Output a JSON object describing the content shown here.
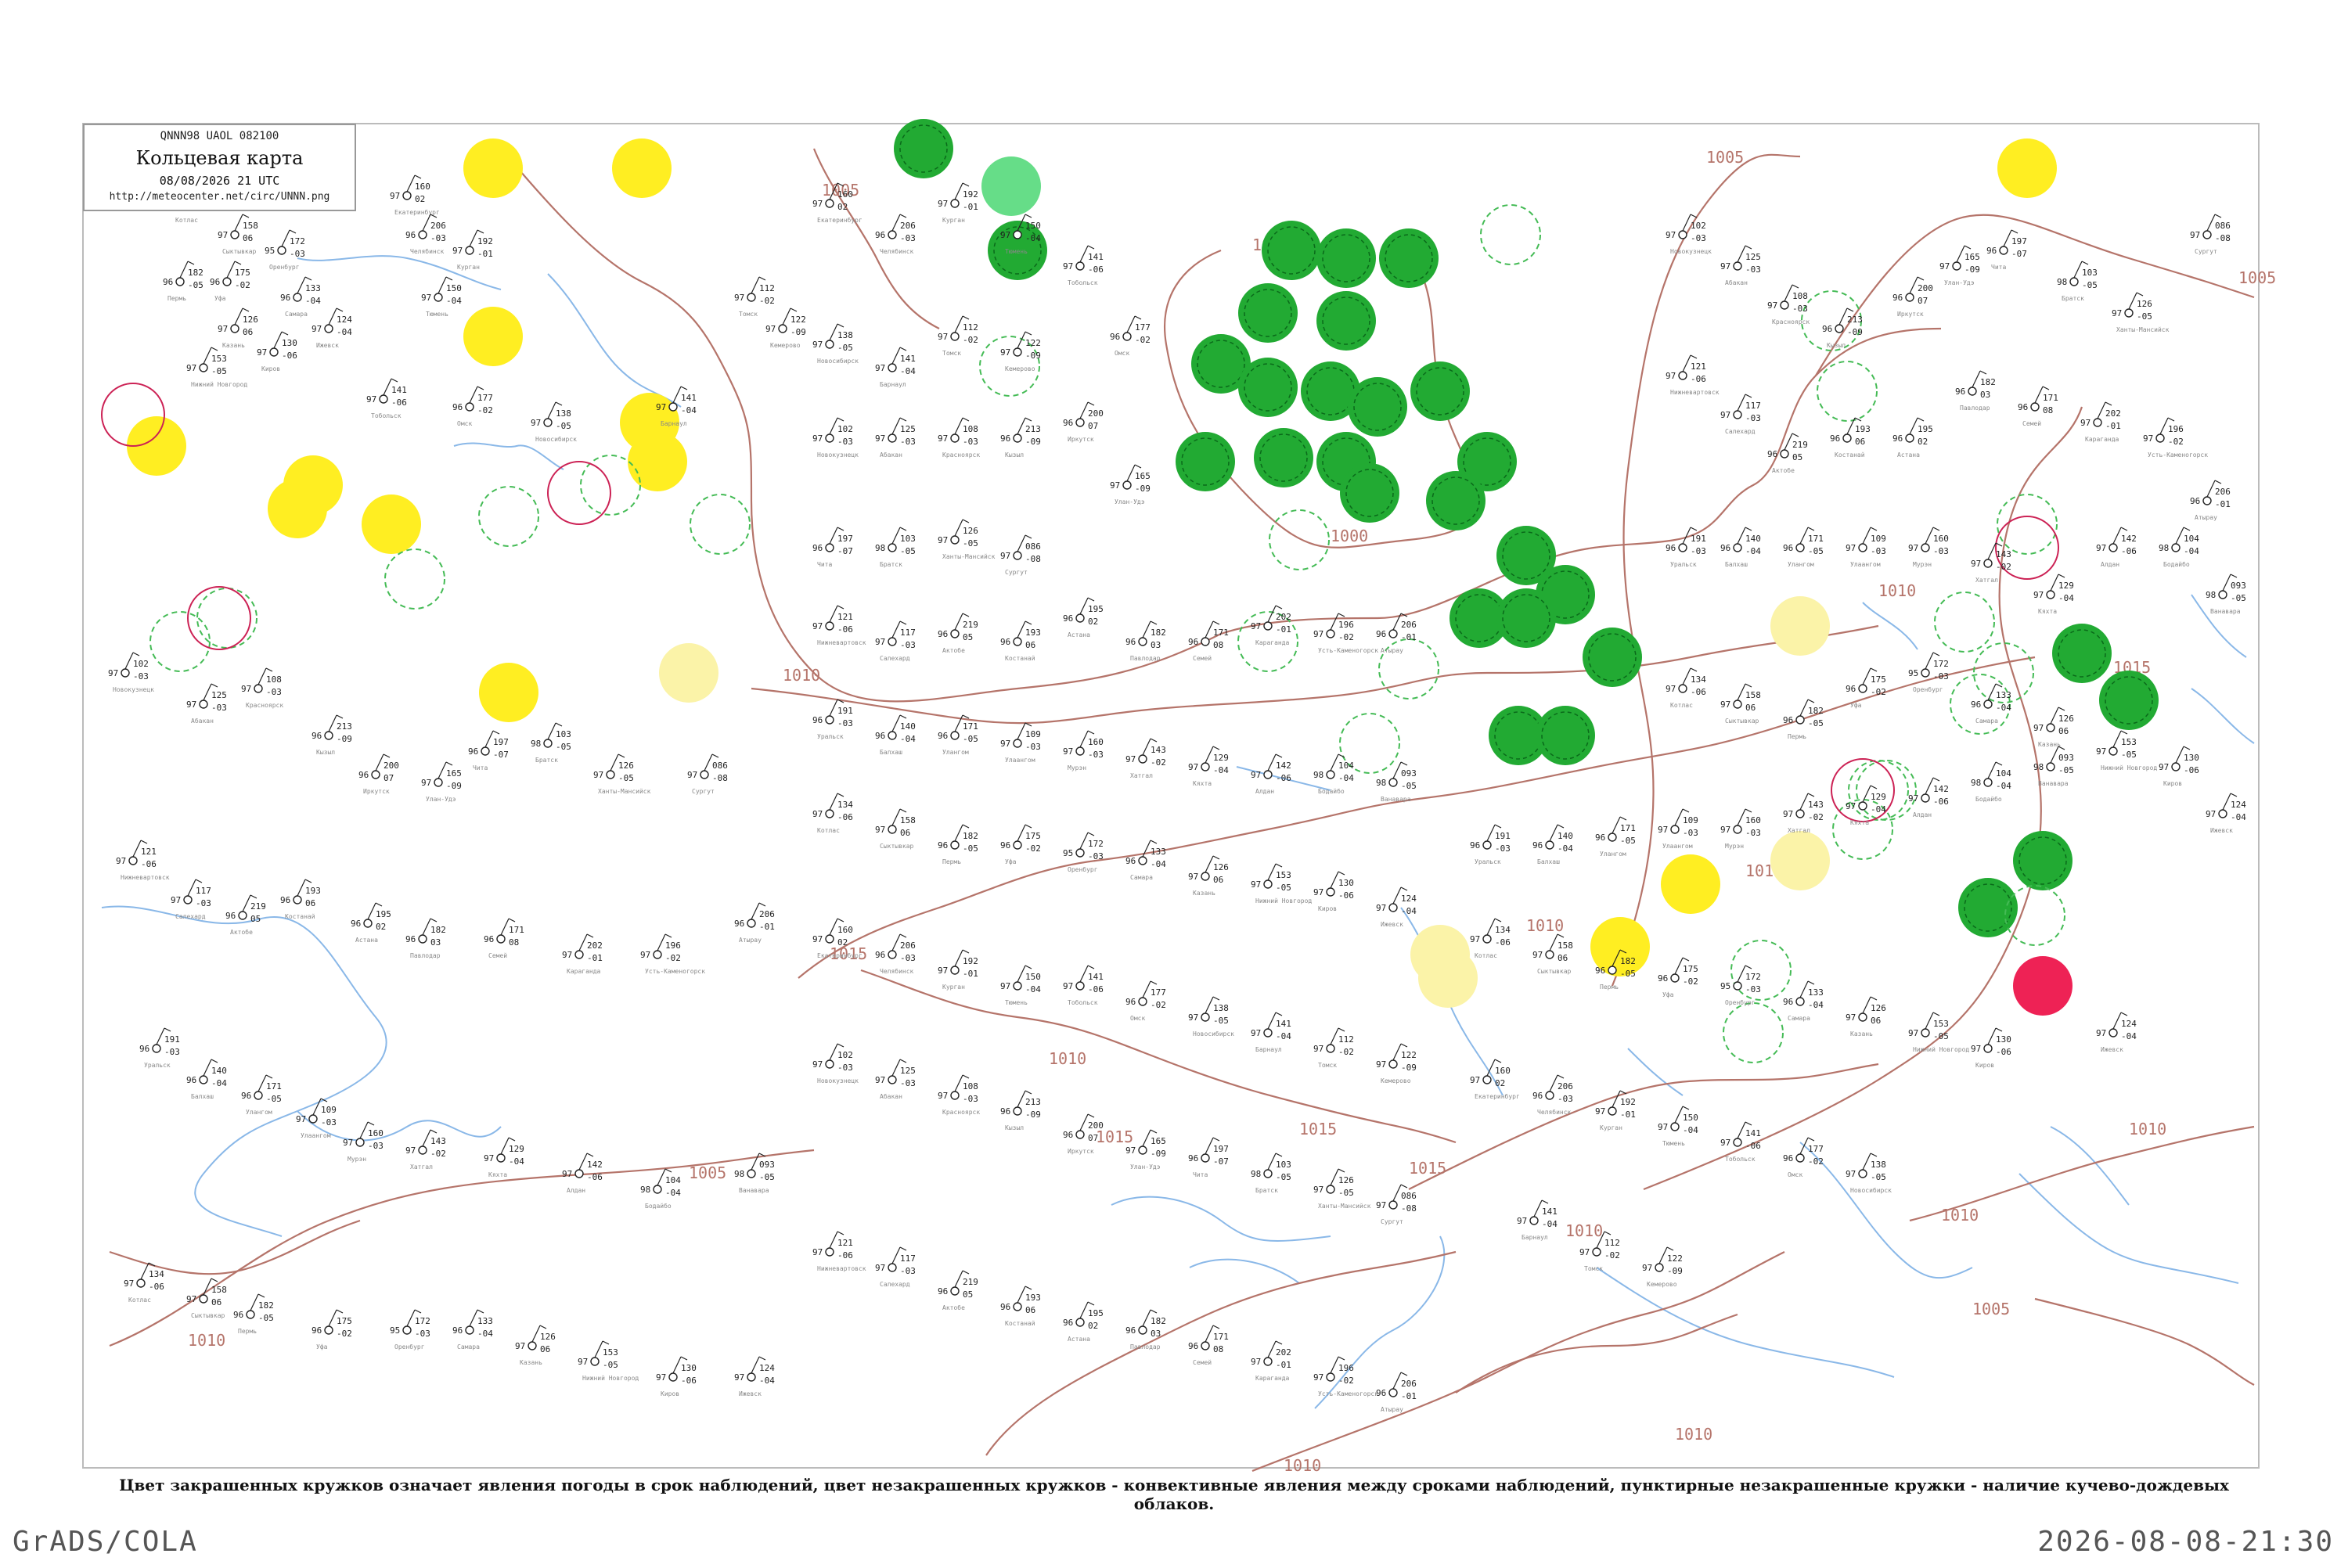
{
  "header": {
    "code_line": "QNNN98  UAOL  082100",
    "title": "Кольцевая карта",
    "datetime": "08/08/2026 21 UTC",
    "url": "http://meteocenter.net/circ/UNNN.png"
  },
  "caption": "Цвет закрашенных кружков означает явления погоды в срок наблюдений, цвет незакрашенных кружков - конвективные явления между сроками наблюдений, пунктирные незакрашенные кружки - наличие кучево-дождевых облаков.",
  "footer": {
    "software": "GrADS/COLA",
    "timestamp": "2026-08-08-21:30"
  },
  "colors": {
    "isobar": "#b5746a",
    "coast": "#8ab8e8",
    "station": "#222222",
    "rain_green": "#22aa33",
    "shower_green": "#66dd88",
    "haze_yellow": "#ffee22",
    "pale_yellow": "#fbf3a8",
    "thunder_red": "#ee2255",
    "cb_dash": "#44bb55",
    "frame": "#bbbbbb"
  },
  "isobar_labels": [
    "1005",
    "1005",
    "1005",
    "1010",
    "1010",
    "1010",
    "1010",
    "1010",
    "1015",
    "1015",
    "1015",
    "1015",
    "1000",
    "1010",
    "1005",
    "1010",
    "1010",
    "1010",
    "1010",
    "1015",
    "1005",
    "1010",
    "1015"
  ],
  "stations": [
    {
      "name": "Котлас",
      "values": [
        "134",
        "97",
        "-06"
      ]
    },
    {
      "name": "Сыктывкар",
      "values": [
        "158",
        "97",
        "06"
      ]
    },
    {
      "name": "Пермь",
      "values": [
        "182",
        "96",
        "-05"
      ]
    },
    {
      "name": "Уфа",
      "values": [
        "175",
        "96",
        "-02"
      ]
    },
    {
      "name": "Оренбург",
      "values": [
        "172",
        "95",
        "-03"
      ]
    },
    {
      "name": "Самара",
      "values": [
        "133",
        "96",
        "-04"
      ]
    },
    {
      "name": "Казань",
      "values": [
        "126",
        "97",
        "06"
      ]
    },
    {
      "name": "Нижний Новгород",
      "values": [
        "153",
        "97",
        "-05"
      ]
    },
    {
      "name": "Киров",
      "values": [
        "130",
        "97",
        "-06"
      ]
    },
    {
      "name": "Ижевск",
      "values": [
        "124",
        "97",
        "-04"
      ]
    },
    {
      "name": "Екатеринбург",
      "values": [
        "160",
        "97",
        "02"
      ]
    },
    {
      "name": "Челябинск",
      "values": [
        "206",
        "96",
        "-03"
      ]
    },
    {
      "name": "Курган",
      "values": [
        "192",
        "97",
        "-01"
      ]
    },
    {
      "name": "Тюмень",
      "values": [
        "150",
        "97",
        "-04"
      ]
    },
    {
      "name": "Тобольск",
      "values": [
        "141",
        "97",
        "-06"
      ]
    },
    {
      "name": "Омск",
      "values": [
        "177",
        "96",
        "-02"
      ]
    },
    {
      "name": "Новосибирск",
      "values": [
        "138",
        "97",
        "-05"
      ]
    },
    {
      "name": "Барнаул",
      "values": [
        "141",
        "97",
        "-04"
      ]
    },
    {
      "name": "Томск",
      "values": [
        "112",
        "97",
        "-02"
      ]
    },
    {
      "name": "Кемерово",
      "values": [
        "122",
        "97",
        "-09"
      ]
    },
    {
      "name": "Новокузнецк",
      "values": [
        "102",
        "97",
        "-03"
      ]
    },
    {
      "name": "Абакан",
      "values": [
        "125",
        "97",
        "-03"
      ]
    },
    {
      "name": "Красноярск",
      "values": [
        "108",
        "97",
        "-03"
      ]
    },
    {
      "name": "Кызыл",
      "values": [
        "213",
        "96",
        "-09"
      ]
    },
    {
      "name": "Иркутск",
      "values": [
        "200",
        "96",
        "07"
      ]
    },
    {
      "name": "Улан-Удэ",
      "values": [
        "165",
        "97",
        "-09"
      ]
    },
    {
      "name": "Чита",
      "values": [
        "197",
        "96",
        "-07"
      ]
    },
    {
      "name": "Братск",
      "values": [
        "103",
        "98",
        "-05"
      ]
    },
    {
      "name": "Ханты-Мансийск",
      "values": [
        "126",
        "97",
        "-05"
      ]
    },
    {
      "name": "Сургут",
      "values": [
        "086",
        "97",
        "-08"
      ]
    },
    {
      "name": "Нижневартовск",
      "values": [
        "121",
        "97",
        "-06"
      ]
    },
    {
      "name": "Салехард",
      "values": [
        "117",
        "97",
        "-03"
      ]
    },
    {
      "name": "Актобе",
      "values": [
        "219",
        "96",
        "05"
      ]
    },
    {
      "name": "Костанай",
      "values": [
        "193",
        "96",
        "06"
      ]
    },
    {
      "name": "Астана",
      "values": [
        "195",
        "96",
        "02"
      ]
    },
    {
      "name": "Павлодар",
      "values": [
        "182",
        "96",
        "03"
      ]
    },
    {
      "name": "Семей",
      "values": [
        "171",
        "96",
        "08"
      ]
    },
    {
      "name": "Караганда",
      "values": [
        "202",
        "97",
        "-01"
      ]
    },
    {
      "name": "Усть-Каменогорск",
      "values": [
        "196",
        "97",
        "-02"
      ]
    },
    {
      "name": "Атырау",
      "values": [
        "206",
        "96",
        "-01"
      ]
    },
    {
      "name": "Уральск",
      "values": [
        "191",
        "96",
        "-03"
      ]
    },
    {
      "name": "Балхаш",
      "values": [
        "140",
        "96",
        "-04"
      ]
    },
    {
      "name": "Улангом",
      "values": [
        "171",
        "96",
        "-05"
      ]
    },
    {
      "name": "Улаангом",
      "values": [
        "109",
        "97",
        "-03"
      ]
    },
    {
      "name": "Мурэн",
      "values": [
        "160",
        "97",
        "-03"
      ]
    },
    {
      "name": "Хатгал",
      "values": [
        "143",
        "97",
        "-02"
      ]
    },
    {
      "name": "Кяхта",
      "values": [
        "129",
        "97",
        "-04"
      ]
    },
    {
      "name": "Алдан",
      "values": [
        "142",
        "97",
        "-06"
      ]
    },
    {
      "name": "Бодайбо",
      "values": [
        "104",
        "98",
        "-04"
      ]
    },
    {
      "name": "Ванавара",
      "values": [
        "093",
        "98",
        "-05"
      ]
    }
  ]
}
